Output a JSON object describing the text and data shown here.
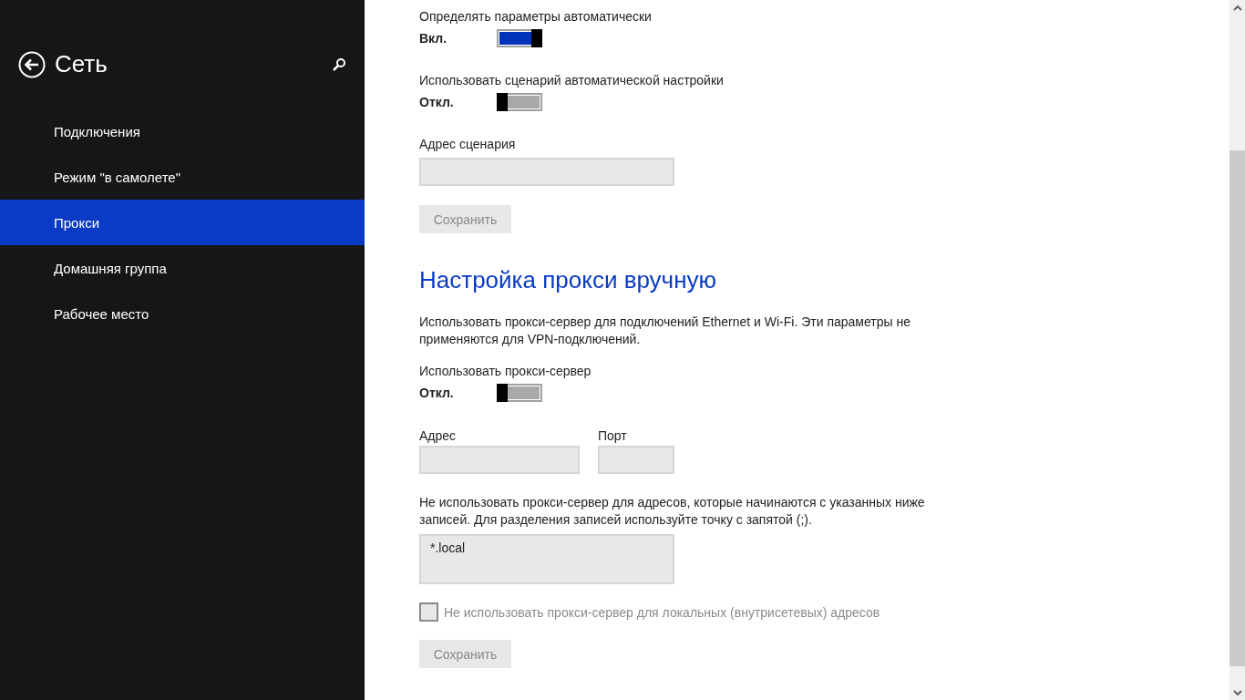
{
  "sidebar": {
    "title": "Сеть",
    "items": [
      {
        "label": "Подключения",
        "selected": false
      },
      {
        "label": "Режим \"в самолете\"",
        "selected": false
      },
      {
        "label": "Прокси",
        "selected": true
      },
      {
        "label": "Домашняя группа",
        "selected": false
      },
      {
        "label": "Рабочее место",
        "selected": false
      }
    ]
  },
  "automatic": {
    "toggles": [
      {
        "label": "Определять параметры автоматически",
        "state": "Вкл.",
        "on": true
      },
      {
        "label": "Использовать сценарий автоматической настройки",
        "state": "Откл.",
        "on": false
      }
    ],
    "script_field": {
      "label": "Адрес сценария"
    },
    "save_button": {
      "label": "Сохранить",
      "disabled": true
    }
  },
  "manual": {
    "heading": "Настройка прокси вручную",
    "description": "Использовать прокси-сервер для подключений Ethernet и Wi-Fi. Эти параметры не применяются для VPN-подключений.",
    "toggle": {
      "label": "Использовать прокси-сервер",
      "state": "Откл.",
      "on": false
    },
    "address_field": {
      "label": "Адрес"
    },
    "port_field": {
      "label": "Порт"
    },
    "exceptions": {
      "label": "Не использовать прокси-сервер для адресов, которые начинаются с указанных ниже записей. Для разделения записей используйте точку с запятой (;).",
      "value": "*.local"
    },
    "local_checkbox": {
      "label": "Не использовать прокси-сервер для локальных (внутрисетевых) адресов",
      "checked": false,
      "disabled": true
    },
    "save_button": {
      "label": "Сохранить",
      "disabled": true
    }
  }
}
